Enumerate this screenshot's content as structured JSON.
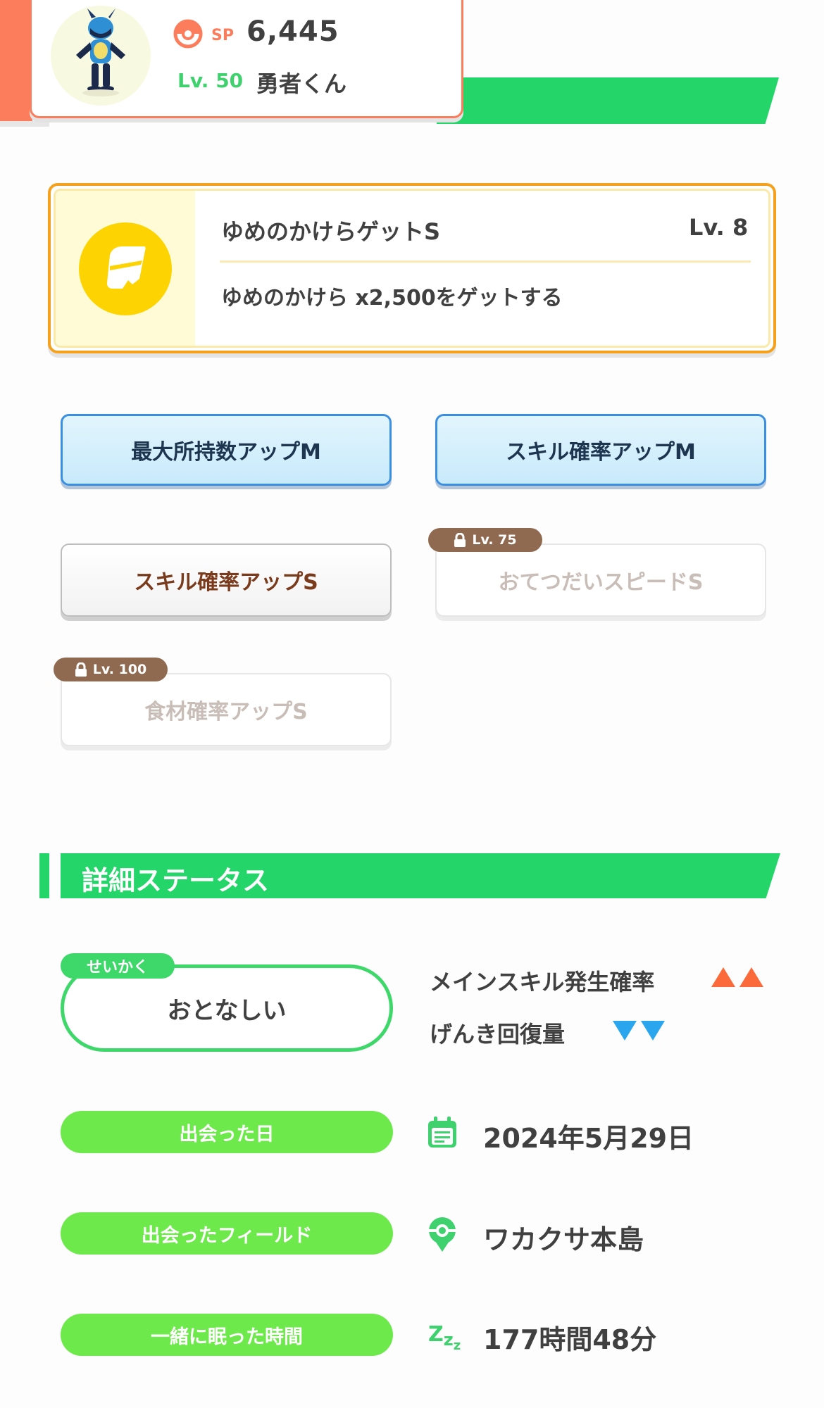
{
  "header": {
    "sp_label": "SP",
    "sp_value": "6,445",
    "level": "Lv. 50",
    "nickname": "勇者くん"
  },
  "main_skill": {
    "name": "ゆめのかけらゲットS",
    "level": "Lv. 8",
    "description": "ゆめのかけら x2,500をゲットする"
  },
  "sub_skills": [
    {
      "label": "最大所持数アップM",
      "state": "blue"
    },
    {
      "label": "スキル確率アップM",
      "state": "blue"
    },
    {
      "label": "スキル確率アップS",
      "state": "white"
    },
    {
      "label": "おてつだいスピードS",
      "state": "locked",
      "unlock_level": "Lv. 75"
    },
    {
      "label": "食材確率アップS",
      "state": "locked",
      "unlock_level": "Lv. 100"
    }
  ],
  "detail_section": {
    "title": "詳細ステータス"
  },
  "nature": {
    "tag": "せいかく",
    "value": "おとなしい",
    "up_effect": "メインスキル発生確率",
    "down_effect": "げんき回復量"
  },
  "info_rows": [
    {
      "label": "出会った日",
      "value": "2024年5月29日",
      "icon": "calendar-icon"
    },
    {
      "label": "出会ったフィールド",
      "value": "ワカクサ本島",
      "icon": "location-pin-icon"
    },
    {
      "label": "一緒に眠った時間",
      "value": "177時間48分",
      "icon": "sleep-zzz-icon"
    }
  ],
  "colors": {
    "accent_green": "#24d66a",
    "pill_green": "#6de94b",
    "orange": "#fb7d5b",
    "skill_gold": "#f6a11e",
    "up_red": "#fb6a3a",
    "down_blue": "#2aa6ef"
  }
}
